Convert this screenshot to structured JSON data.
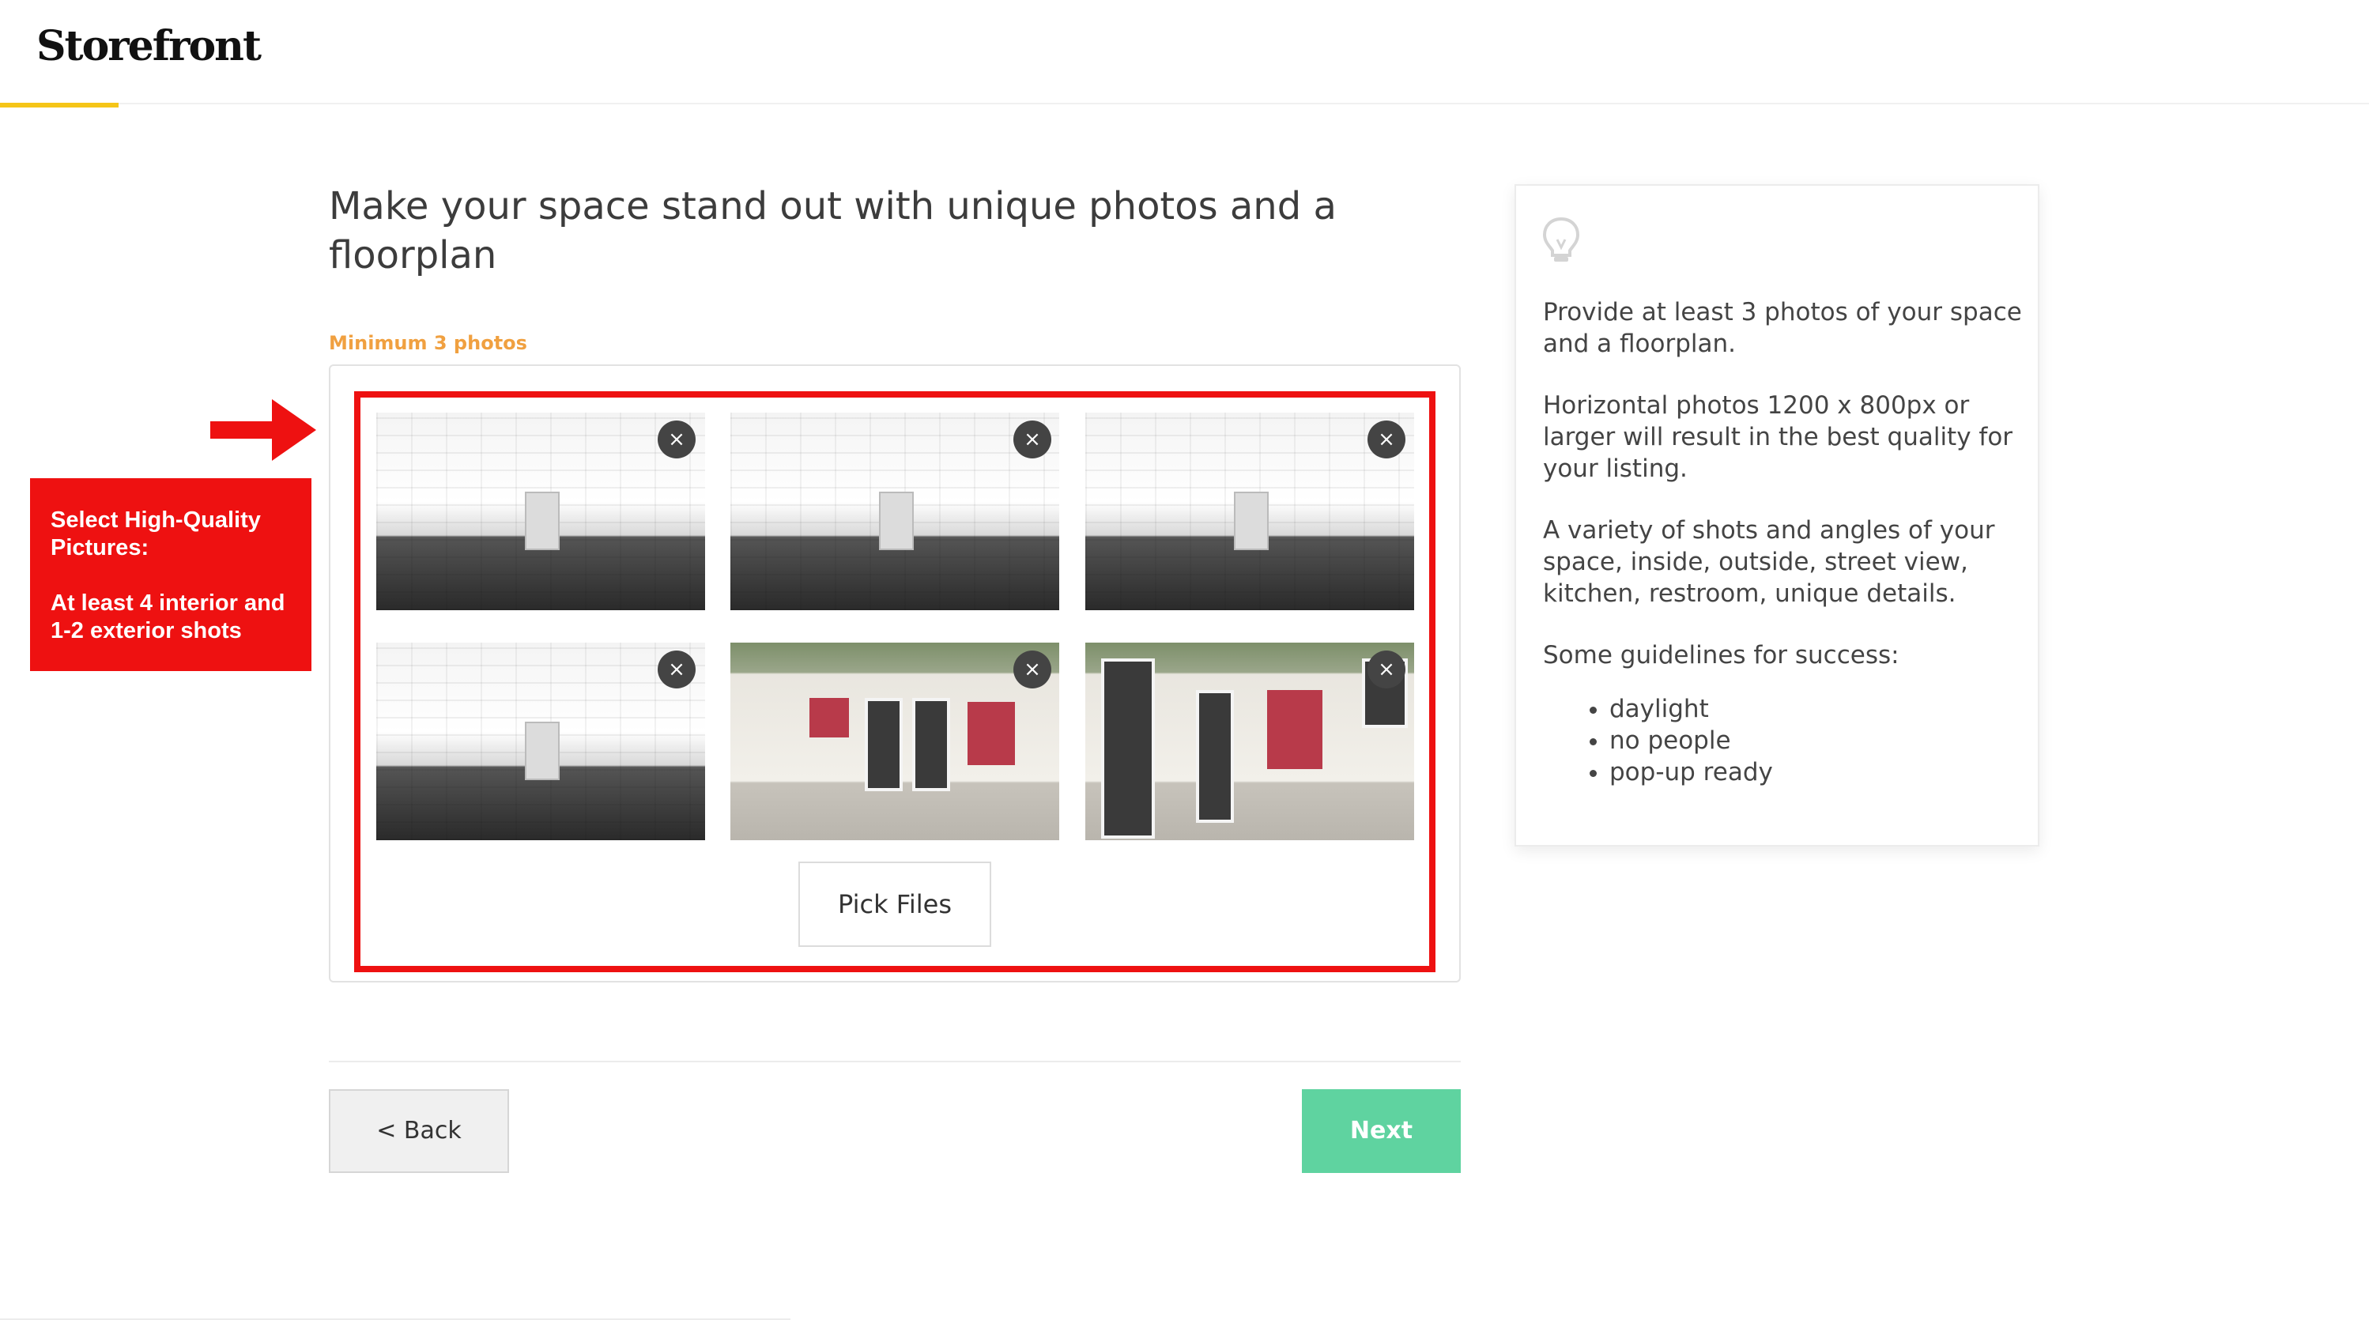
{
  "header": {
    "logo": "Storefront"
  },
  "page": {
    "title": "Make your space stand out with unique photos and a floorplan",
    "min_label": "Minimum 3 photos",
    "close_glyph": "×",
    "pick_files_label": "Pick Files",
    "back_label": "< Back",
    "next_label": "Next",
    "photos": [
      {
        "kind": "interior"
      },
      {
        "kind": "interior"
      },
      {
        "kind": "interior"
      },
      {
        "kind": "interior"
      },
      {
        "kind": "exterior"
      },
      {
        "kind": "exterior"
      }
    ]
  },
  "annotation": {
    "heading": "Select High-Quality Pictures:",
    "body": "At least 4 interior and 1-2 exterior shots"
  },
  "tips": {
    "icon": "lightbulb-icon",
    "p1": "Provide at least 3 photos of your space and a floorplan.",
    "p2": "Horizontal photos 1200 x 800px or larger will result in the best quality for your listing.",
    "p3": "A variety of shots and angles of your space, inside, outside, street view, kitchen, restroom, unique details.",
    "p4": "Some guidelines for success:",
    "guidelines": [
      "daylight",
      "no people",
      "pop-up ready"
    ]
  },
  "colors": {
    "accent_yellow": "#f5c518",
    "annotation_red": "#ee1111",
    "label_orange": "#f0a040",
    "next_green": "#5fd3a0"
  }
}
